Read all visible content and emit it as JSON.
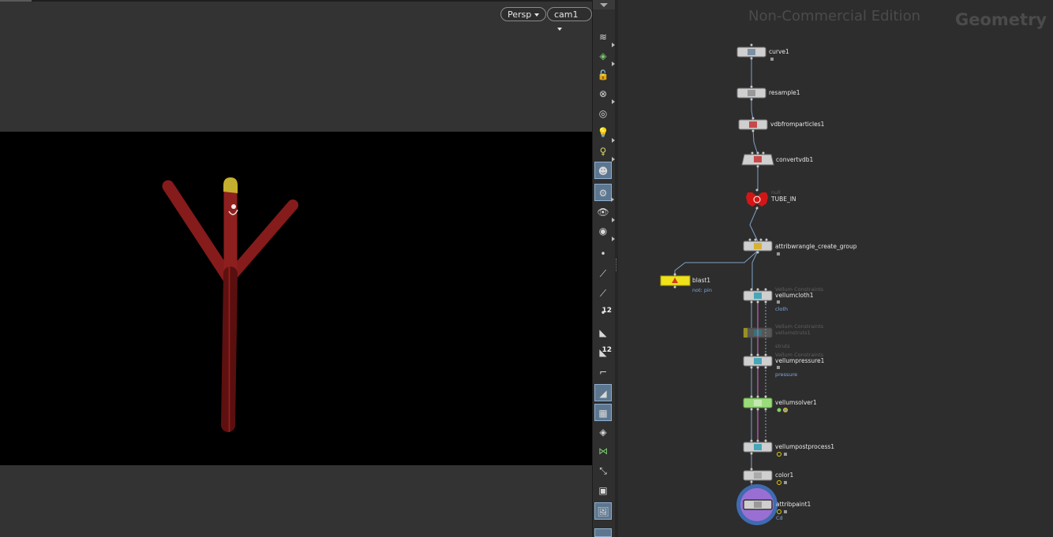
{
  "viewport": {
    "persp_label": "Persp",
    "camera_label": "cam1"
  },
  "network": {
    "edition_label": "Non-Commercial Edition",
    "context_label": "Geometry",
    "nodes": {
      "curve1": "curve1",
      "resample1": "resample1",
      "vdbfromparticles1": "vdbfromparticles1",
      "convertvdb1": "convertvdb1",
      "null_type": "null",
      "tube_in": "TUBE_IN",
      "attribwrangle": "attribwrangle_create_group",
      "blast1": "blast1",
      "blast1_group": "not: pin",
      "vellum_type_1": "Vellum Constraints",
      "vellumcloth1": "vellumcloth1",
      "vellumcloth1_group": "cloth",
      "vellum_type_2": "Vellum Constraints",
      "vellumstruts1": "vellumstruts1",
      "vellumstruts1_group": "struts",
      "vellum_type_3": "Vellum Constraints",
      "vellumpressure1": "vellumpressure1",
      "vellumpressure1_group": "pressure",
      "vellumsolver1": "vellumsolver1",
      "vellumpostprocess1": "vellumpostprocess1",
      "color1": "color1",
      "attribpaint1": "attribpaint1",
      "attribpaint1_attr": "Cd"
    }
  },
  "colors": {
    "tube_body": "#8b1c1c",
    "tube_tip": "#c9b22a",
    "null_node": "#d41515",
    "blast_node": "#f0e21a",
    "solver_node": "#9bdc7a",
    "display_ring": "#3f6bb0",
    "constraint_wire": "#e070d8",
    "wire": "#7fa2c8"
  },
  "icons": [
    "persp-dropdown",
    "camera-dropdown",
    "selection-icon",
    "lock-icon",
    "light-icon",
    "ghost-icon",
    "point-icon",
    "brush-icon",
    "display-options-icon"
  ]
}
